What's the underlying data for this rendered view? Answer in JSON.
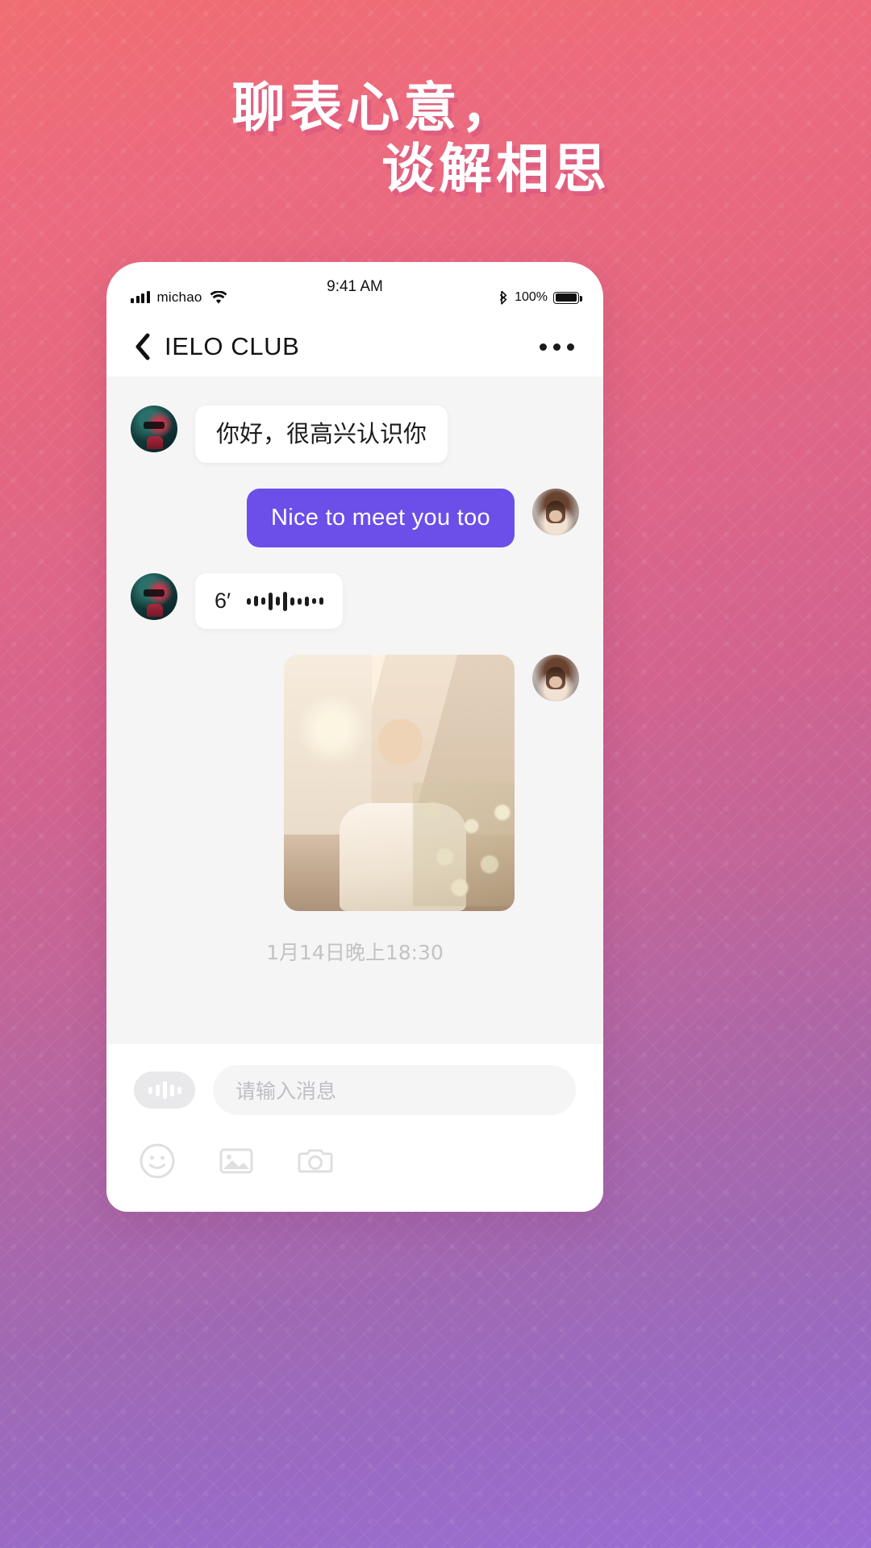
{
  "theme": {
    "gradient_top": "#f06d72",
    "gradient_bottom": "#9a6dd4",
    "accent_bubble": "#6c4ee8",
    "chat_bg": "#f5f5f6",
    "headline_color": "#ffffff",
    "headline_shadow": "#ce4c80"
  },
  "headline": {
    "line1": "聊表心意，",
    "line2": "谈解相思"
  },
  "status_bar": {
    "signal_icon": "signal-bars-icon",
    "carrier": "michao",
    "wifi_icon": "wifi-icon",
    "time": "9:41 AM",
    "bluetooth_icon": "bluetooth-icon",
    "battery_percent": "100%",
    "battery_icon": "battery-full-icon"
  },
  "navbar": {
    "back_icon": "back-chevron-icon",
    "title": "IELO CLUB",
    "more_icon": "more-dots-icon"
  },
  "chat": {
    "messages": [
      {
        "id": "msg-1",
        "direction": "incoming",
        "type": "text",
        "avatar": "contact-avatar",
        "text": "你好，很高兴认识你"
      },
      {
        "id": "msg-2",
        "direction": "outgoing",
        "type": "text",
        "avatar": "self-avatar",
        "text": "Nice to meet you too"
      },
      {
        "id": "msg-3",
        "direction": "incoming",
        "type": "voice",
        "avatar": "contact-avatar",
        "duration": "6′",
        "waveform_icon": "audio-waveform-icon"
      },
      {
        "id": "msg-4",
        "direction": "outgoing",
        "type": "image",
        "avatar": "self-avatar",
        "image_alt": "photo-message"
      }
    ],
    "timestamp": "1月14日晚上18:30"
  },
  "input_bar": {
    "voice_button_icon": "voice-record-icon",
    "placeholder": "请输入消息",
    "value": "",
    "actions": [
      {
        "name": "emoji-icon",
        "label": "emoji"
      },
      {
        "name": "image-icon",
        "label": "image"
      },
      {
        "name": "camera-icon",
        "label": "camera"
      }
    ]
  }
}
